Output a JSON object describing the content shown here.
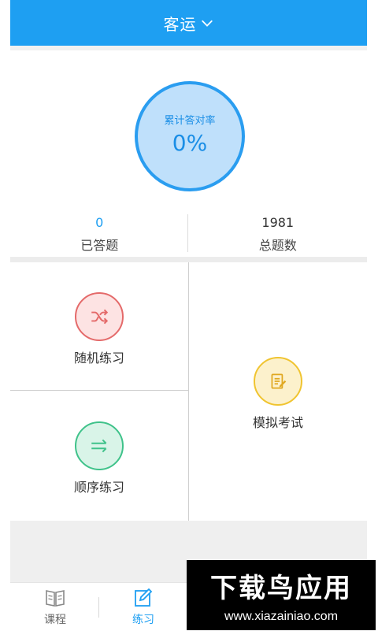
{
  "header": {
    "title": "客运"
  },
  "accuracy": {
    "label": "累计答对率",
    "value": "0%"
  },
  "stats": {
    "answered": {
      "value": "0",
      "label": "已答题"
    },
    "total": {
      "value": "1981",
      "label": "总题数"
    }
  },
  "practice": {
    "random": {
      "label": "随机练习",
      "icon": "shuffle-icon"
    },
    "sequential": {
      "label": "顺序练习",
      "icon": "right-arrows-icon"
    },
    "mock_exam": {
      "label": "模拟考试",
      "icon": "exam-paper-icon"
    }
  },
  "bottom_nav": {
    "course": {
      "label": "课程",
      "icon": "book-icon"
    },
    "practice": {
      "label": "练习",
      "icon": "edit-icon"
    }
  },
  "watermark": {
    "logo_text": "下载鸟应用",
    "url": "www.xiazainiao.com"
  },
  "colors": {
    "primary": "#1e9ff2",
    "random_stroke": "#e46a6a",
    "random_fill": "#fde3e3",
    "sequential_stroke": "#3fc28a",
    "sequential_fill": "#d9f4e8",
    "exam_stroke": "#f0c430",
    "exam_fill": "#fcf1cc"
  }
}
